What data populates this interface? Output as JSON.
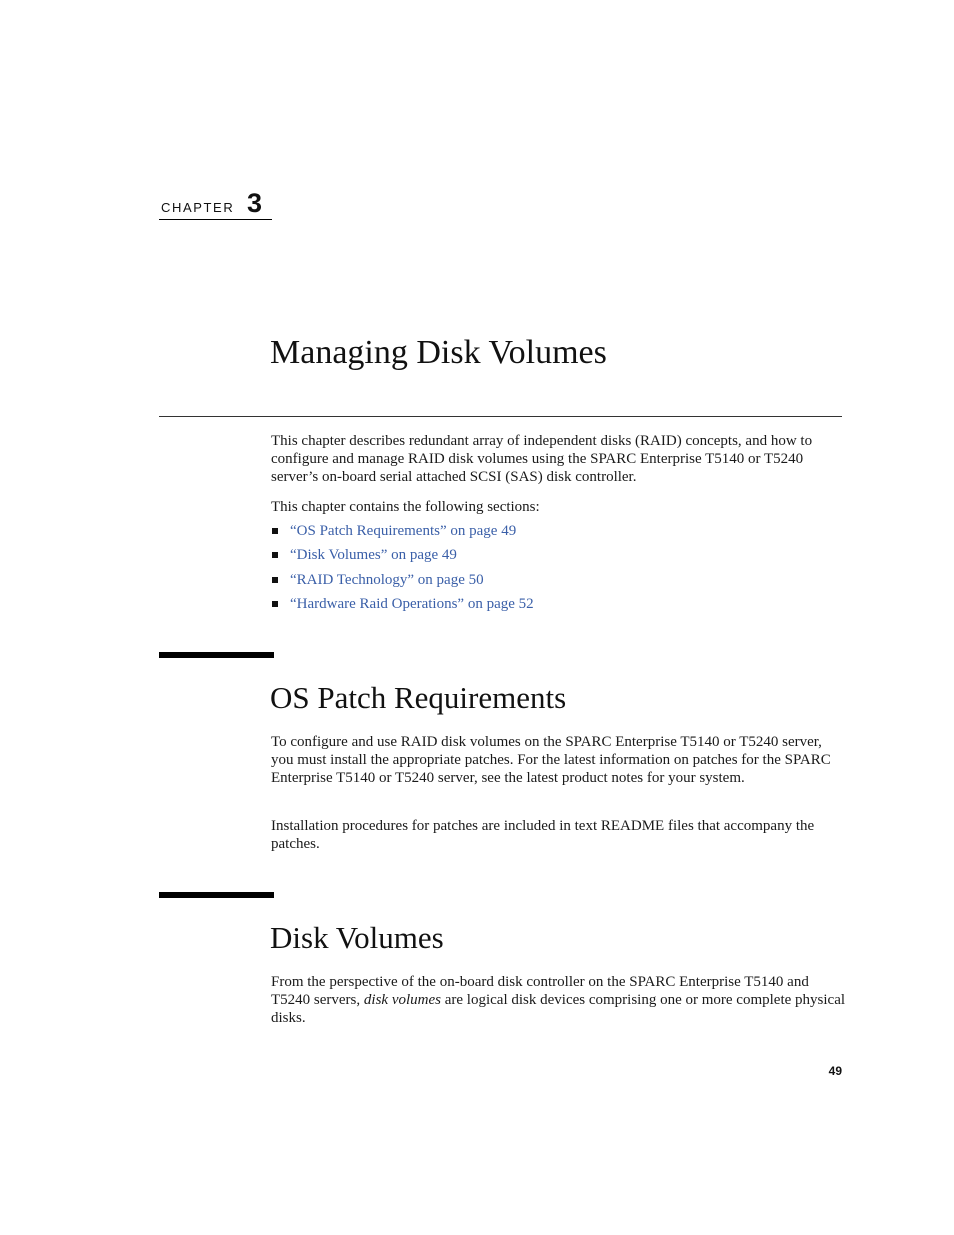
{
  "chapter": {
    "label": "CHAPTER",
    "number": "3"
  },
  "title": "Managing Disk Volumes",
  "intro": {
    "paragraph": "This chapter describes redundant array of independent disks (RAID) concepts, and how to configure and manage RAID disk volumes using the SPARC Enterprise T5140 or T5240 server’s on-board serial attached SCSI (SAS) disk controller.",
    "sections_lead": "This chapter contains the following sections:",
    "links": [
      {
        "label": "“OS Patch Requirements” on page 49"
      },
      {
        "label": "“Disk Volumes” on page 49"
      },
      {
        "label": "“RAID Technology” on page 50"
      },
      {
        "label": "“Hardware Raid Operations” on page 52"
      }
    ]
  },
  "sections": [
    {
      "heading": "OS Patch Requirements",
      "paragraphs": [
        "To configure and use RAID disk volumes on the SPARC Enterprise T5140 or T5240 server, you must install the appropriate patches. For the latest information on patches for the SPARC Enterprise T5140 or T5240 server, see the latest product notes for your system.",
        "Installation procedures for patches are included in text README files that accompany the patches."
      ]
    },
    {
      "heading": "Disk Volumes",
      "paragraph_parts": {
        "before": "From the perspective of the on-board disk controller on the SPARC Enterprise T5140 and T5240 servers, ",
        "emphasis": "disk volumes",
        "after": " are logical disk devices comprising one or more complete physical disks."
      }
    }
  ],
  "page_number": "49"
}
